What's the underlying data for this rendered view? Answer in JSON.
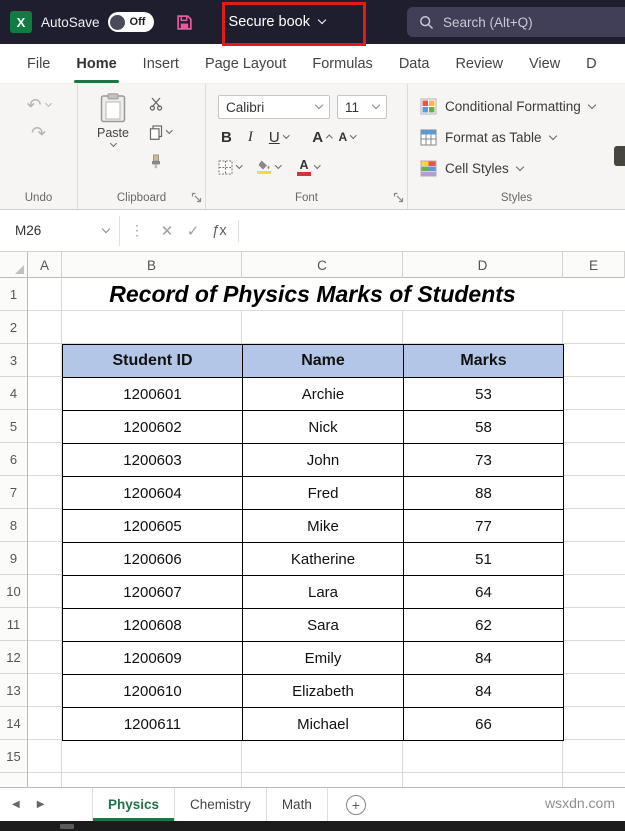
{
  "titlebar": {
    "autosave_label": "AutoSave",
    "autosave_state": "Off",
    "workbook_name": "Secure book",
    "search_placeholder": "Search (Alt+Q)"
  },
  "menu": {
    "tabs": [
      "File",
      "Home",
      "Insert",
      "Page Layout",
      "Formulas",
      "Data",
      "Review",
      "View",
      "D"
    ],
    "active_tab": "Home"
  },
  "ribbon": {
    "undo_group_label": "Undo",
    "clipboard_group_label": "Clipboard",
    "font_group_label": "Font",
    "styles_group_label": "Styles",
    "paste_label": "Paste",
    "font_name": "Calibri",
    "font_size": "11",
    "bold_label": "B",
    "italic_label": "I",
    "underline_label": "U",
    "conditional_formatting_label": "Conditional Formatting",
    "format_as_table_label": "Format as Table",
    "cell_styles_label": "Cell Styles"
  },
  "formula_bar": {
    "name_box_value": "M26",
    "fx_label": "x"
  },
  "grid": {
    "column_headers": [
      "A",
      "B",
      "C",
      "D",
      "E"
    ],
    "row_headers": [
      "1",
      "2",
      "3",
      "4",
      "5",
      "6",
      "7",
      "8",
      "9",
      "10",
      "11",
      "12",
      "13",
      "14",
      "15"
    ],
    "title": "Record of Physics Marks of Students"
  },
  "sheet": {
    "headers": [
      "Student ID",
      "Name",
      "Marks"
    ],
    "rows": [
      [
        "1200601",
        "Archie",
        "53"
      ],
      [
        "1200602",
        "Nick",
        "58"
      ],
      [
        "1200603",
        "John",
        "73"
      ],
      [
        "1200604",
        "Fred",
        "88"
      ],
      [
        "1200605",
        "Mike",
        "77"
      ],
      [
        "1200606",
        "Katherine",
        "51"
      ],
      [
        "1200607",
        "Lara",
        "64"
      ],
      [
        "1200608",
        "Sara",
        "62"
      ],
      [
        "1200609",
        "Emily",
        "84"
      ],
      [
        "1200610",
        "Elizabeth",
        "84"
      ],
      [
        "1200611",
        "Michael",
        "66"
      ]
    ]
  },
  "sheet_tabs": {
    "tabs": [
      "Physics",
      "Chemistry",
      "Math"
    ],
    "active": "Physics"
  },
  "watermark": "wsxdn.com",
  "colors": {
    "excel_green": "#107c41",
    "active_tab_green": "#217346",
    "annotation_red": "#e11a1a",
    "header_fill": "#b4c6e7",
    "fill_swatch": "#ffd83d",
    "font_swatch": "#d13438"
  }
}
